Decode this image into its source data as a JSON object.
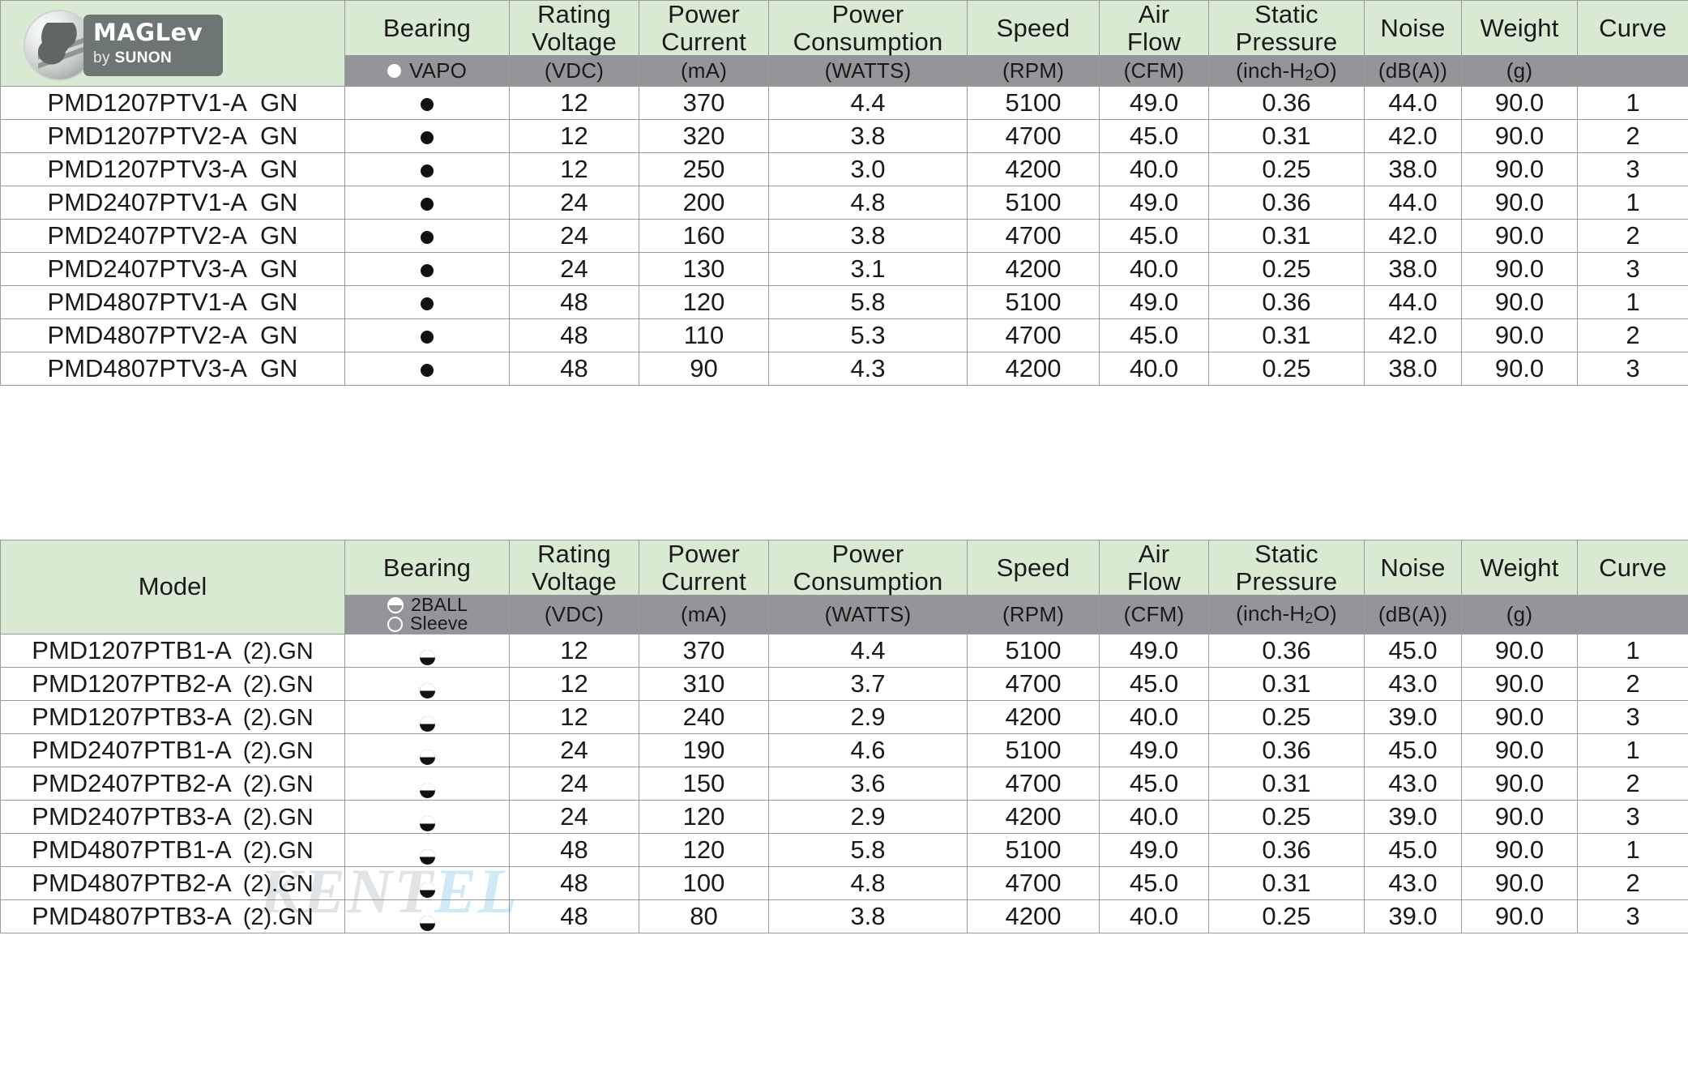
{
  "logo": {
    "brand": "MAGLev",
    "sub_prefix": "by ",
    "sub_brand": "SUNON",
    "icon": "maglev-fan-badge-icon"
  },
  "colors": {
    "header_green": "#d9ead3",
    "unit_gray": "#939598",
    "border": "#9a9a9a",
    "text": "#1a1a1a",
    "unit_text": "#ffffff"
  },
  "columns": {
    "model": "Model",
    "bearing": "Bearing",
    "rating_voltage_l1": "Rating",
    "rating_voltage_l2": "Voltage",
    "power_current_l1": "Power",
    "power_current_l2": "Current",
    "power_consumption_l1": "Power",
    "power_consumption_l2": "Consumption",
    "speed": "Speed",
    "air_flow_l1": "Air",
    "air_flow_l2": "Flow",
    "static_pressure_l1": "Static",
    "static_pressure_l2": "Pressure",
    "noise": "Noise",
    "weight": "Weight",
    "curve": "Curve"
  },
  "units": {
    "voltage": "(VDC)",
    "current": "(mA)",
    "consumption": "(WATTS)",
    "speed": "(RPM)",
    "air_flow": "(CFM)",
    "static_pressure_pre": "(inch-H",
    "static_pressure_sub": "2",
    "static_pressure_post": "O)",
    "noise": "(dB(A))",
    "weight": "(g)",
    "curve": ""
  },
  "table_one": {
    "bearing_legend": {
      "vapo_label": "VAPO",
      "vapo_icon": "filled-circle-icon"
    },
    "rows": [
      {
        "model": "PMD1207PTV1-A",
        "suffix": "GN",
        "bearing_icon": "filled-circle-icon",
        "voltage": "12",
        "current": "370",
        "consumption": "4.4",
        "speed": "5100",
        "air_flow": "49.0",
        "static_pressure": "0.36",
        "noise": "44.0",
        "weight": "90.0",
        "curve": "1"
      },
      {
        "model": "PMD1207PTV2-A",
        "suffix": "GN",
        "bearing_icon": "filled-circle-icon",
        "voltage": "12",
        "current": "320",
        "consumption": "3.8",
        "speed": "4700",
        "air_flow": "45.0",
        "static_pressure": "0.31",
        "noise": "42.0",
        "weight": "90.0",
        "curve": "2"
      },
      {
        "model": "PMD1207PTV3-A",
        "suffix": "GN",
        "bearing_icon": "filled-circle-icon",
        "voltage": "12",
        "current": "250",
        "consumption": "3.0",
        "speed": "4200",
        "air_flow": "40.0",
        "static_pressure": "0.25",
        "noise": "38.0",
        "weight": "90.0",
        "curve": "3"
      },
      {
        "model": "PMD2407PTV1-A",
        "suffix": "GN",
        "bearing_icon": "filled-circle-icon",
        "voltage": "24",
        "current": "200",
        "consumption": "4.8",
        "speed": "5100",
        "air_flow": "49.0",
        "static_pressure": "0.36",
        "noise": "44.0",
        "weight": "90.0",
        "curve": "1"
      },
      {
        "model": "PMD2407PTV2-A",
        "suffix": "GN",
        "bearing_icon": "filled-circle-icon",
        "voltage": "24",
        "current": "160",
        "consumption": "3.8",
        "speed": "4700",
        "air_flow": "45.0",
        "static_pressure": "0.31",
        "noise": "42.0",
        "weight": "90.0",
        "curve": "2"
      },
      {
        "model": "PMD2407PTV3-A",
        "suffix": "GN",
        "bearing_icon": "filled-circle-icon",
        "voltage": "24",
        "current": "130",
        "consumption": "3.1",
        "speed": "4200",
        "air_flow": "40.0",
        "static_pressure": "0.25",
        "noise": "38.0",
        "weight": "90.0",
        "curve": "3"
      },
      {
        "model": "PMD4807PTV1-A",
        "suffix": "GN",
        "bearing_icon": "filled-circle-icon",
        "voltage": "48",
        "current": "120",
        "consumption": "5.8",
        "speed": "5100",
        "air_flow": "49.0",
        "static_pressure": "0.36",
        "noise": "44.0",
        "weight": "90.0",
        "curve": "1"
      },
      {
        "model": "PMD4807PTV2-A",
        "suffix": "GN",
        "bearing_icon": "filled-circle-icon",
        "voltage": "48",
        "current": "110",
        "consumption": "5.3",
        "speed": "4700",
        "air_flow": "45.0",
        "static_pressure": "0.31",
        "noise": "42.0",
        "weight": "90.0",
        "curve": "2"
      },
      {
        "model": "PMD4807PTV3-A",
        "suffix": "GN",
        "bearing_icon": "filled-circle-icon",
        "voltage": "48",
        "current": "90",
        "consumption": "4.3",
        "speed": "4200",
        "air_flow": "40.0",
        "static_pressure": "0.25",
        "noise": "38.0",
        "weight": "90.0",
        "curve": "3"
      }
    ]
  },
  "table_two": {
    "bearing_legend": {
      "ball_label": "2BALL",
      "ball_icon": "quartered-circle-icon",
      "sleeve_label": "Sleeve",
      "sleeve_icon": "hollow-circle-icon"
    },
    "rows": [
      {
        "model": "PMD1207PTB1-A",
        "suffix": "(2).GN",
        "bearing_icon": "quartered-circle-icon",
        "voltage": "12",
        "current": "370",
        "consumption": "4.4",
        "speed": "5100",
        "air_flow": "49.0",
        "static_pressure": "0.36",
        "noise": "45.0",
        "weight": "90.0",
        "curve": "1"
      },
      {
        "model": "PMD1207PTB2-A",
        "suffix": "(2).GN",
        "bearing_icon": "quartered-circle-icon",
        "voltage": "12",
        "current": "310",
        "consumption": "3.7",
        "speed": "4700",
        "air_flow": "45.0",
        "static_pressure": "0.31",
        "noise": "43.0",
        "weight": "90.0",
        "curve": "2"
      },
      {
        "model": "PMD1207PTB3-A",
        "suffix": "(2).GN",
        "bearing_icon": "quartered-circle-icon",
        "voltage": "12",
        "current": "240",
        "consumption": "2.9",
        "speed": "4200",
        "air_flow": "40.0",
        "static_pressure": "0.25",
        "noise": "39.0",
        "weight": "90.0",
        "curve": "3"
      },
      {
        "model": "PMD2407PTB1-A",
        "suffix": "(2).GN",
        "bearing_icon": "quartered-circle-icon",
        "voltage": "24",
        "current": "190",
        "consumption": "4.6",
        "speed": "5100",
        "air_flow": "49.0",
        "static_pressure": "0.36",
        "noise": "45.0",
        "weight": "90.0",
        "curve": "1"
      },
      {
        "model": "PMD2407PTB2-A",
        "suffix": "(2).GN",
        "bearing_icon": "quartered-circle-icon",
        "voltage": "24",
        "current": "150",
        "consumption": "3.6",
        "speed": "4700",
        "air_flow": "45.0",
        "static_pressure": "0.31",
        "noise": "43.0",
        "weight": "90.0",
        "curve": "2"
      },
      {
        "model": "PMD2407PTB3-A",
        "suffix": "(2).GN",
        "bearing_icon": "quartered-circle-icon",
        "voltage": "24",
        "current": "120",
        "consumption": "2.9",
        "speed": "4200",
        "air_flow": "40.0",
        "static_pressure": "0.25",
        "noise": "39.0",
        "weight": "90.0",
        "curve": "3"
      },
      {
        "model": "PMD4807PTB1-A",
        "suffix": "(2).GN",
        "bearing_icon": "quartered-circle-icon",
        "voltage": "48",
        "current": "120",
        "consumption": "5.8",
        "speed": "5100",
        "air_flow": "49.0",
        "static_pressure": "0.36",
        "noise": "45.0",
        "weight": "90.0",
        "curve": "1"
      },
      {
        "model": "PMD4807PTB2-A",
        "suffix": "(2).GN",
        "bearing_icon": "quartered-circle-icon",
        "voltage": "48",
        "current": "100",
        "consumption": "4.8",
        "speed": "4700",
        "air_flow": "45.0",
        "static_pressure": "0.31",
        "noise": "43.0",
        "weight": "90.0",
        "curve": "2"
      },
      {
        "model": "PMD4807PTB3-A",
        "suffix": "(2).GN",
        "bearing_icon": "quartered-circle-icon",
        "voltage": "48",
        "current": "80",
        "consumption": "3.8",
        "speed": "4200",
        "air_flow": "40.0",
        "static_pressure": "0.25",
        "noise": "39.0",
        "weight": "90.0",
        "curve": "3"
      }
    ]
  },
  "watermark": {
    "part_a": "KENT",
    "part_b": "EL"
  }
}
